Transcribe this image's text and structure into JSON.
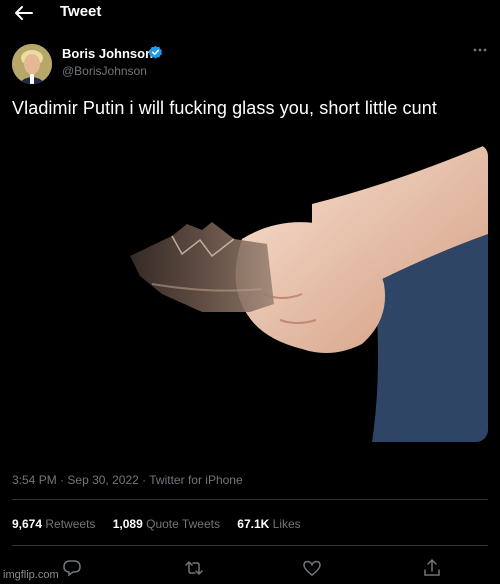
{
  "header": {
    "title": "Tweet",
    "back_icon": "arrow-left-icon"
  },
  "author": {
    "display_name": "Boris Johnson",
    "handle": "@BorisJohnson",
    "verified": true,
    "verified_color": "#1d9bf0"
  },
  "tweet": {
    "text": "Vladimir Putin i will fucking glass you, short little cunt",
    "media_description_icon": "hand-holding-broken-bottle-image",
    "time": "3:54 PM",
    "date": "Sep 30, 2022",
    "source": "Twitter for iPhone",
    "meta_separator": "·"
  },
  "stats": {
    "retweets_count": "9,674",
    "retweets_label": "Retweets",
    "quotes_count": "1,089",
    "quotes_label": "Quote Tweets",
    "likes_count": "67.1K",
    "likes_label": "Likes"
  },
  "actions": [
    "reply-icon",
    "retweet-icon",
    "like-icon",
    "share-icon"
  ],
  "watermark": "imgflip.com",
  "colors": {
    "background": "#000000",
    "text": "#e7e9ea",
    "secondary": "#71767b",
    "divider": "#2f3336"
  }
}
